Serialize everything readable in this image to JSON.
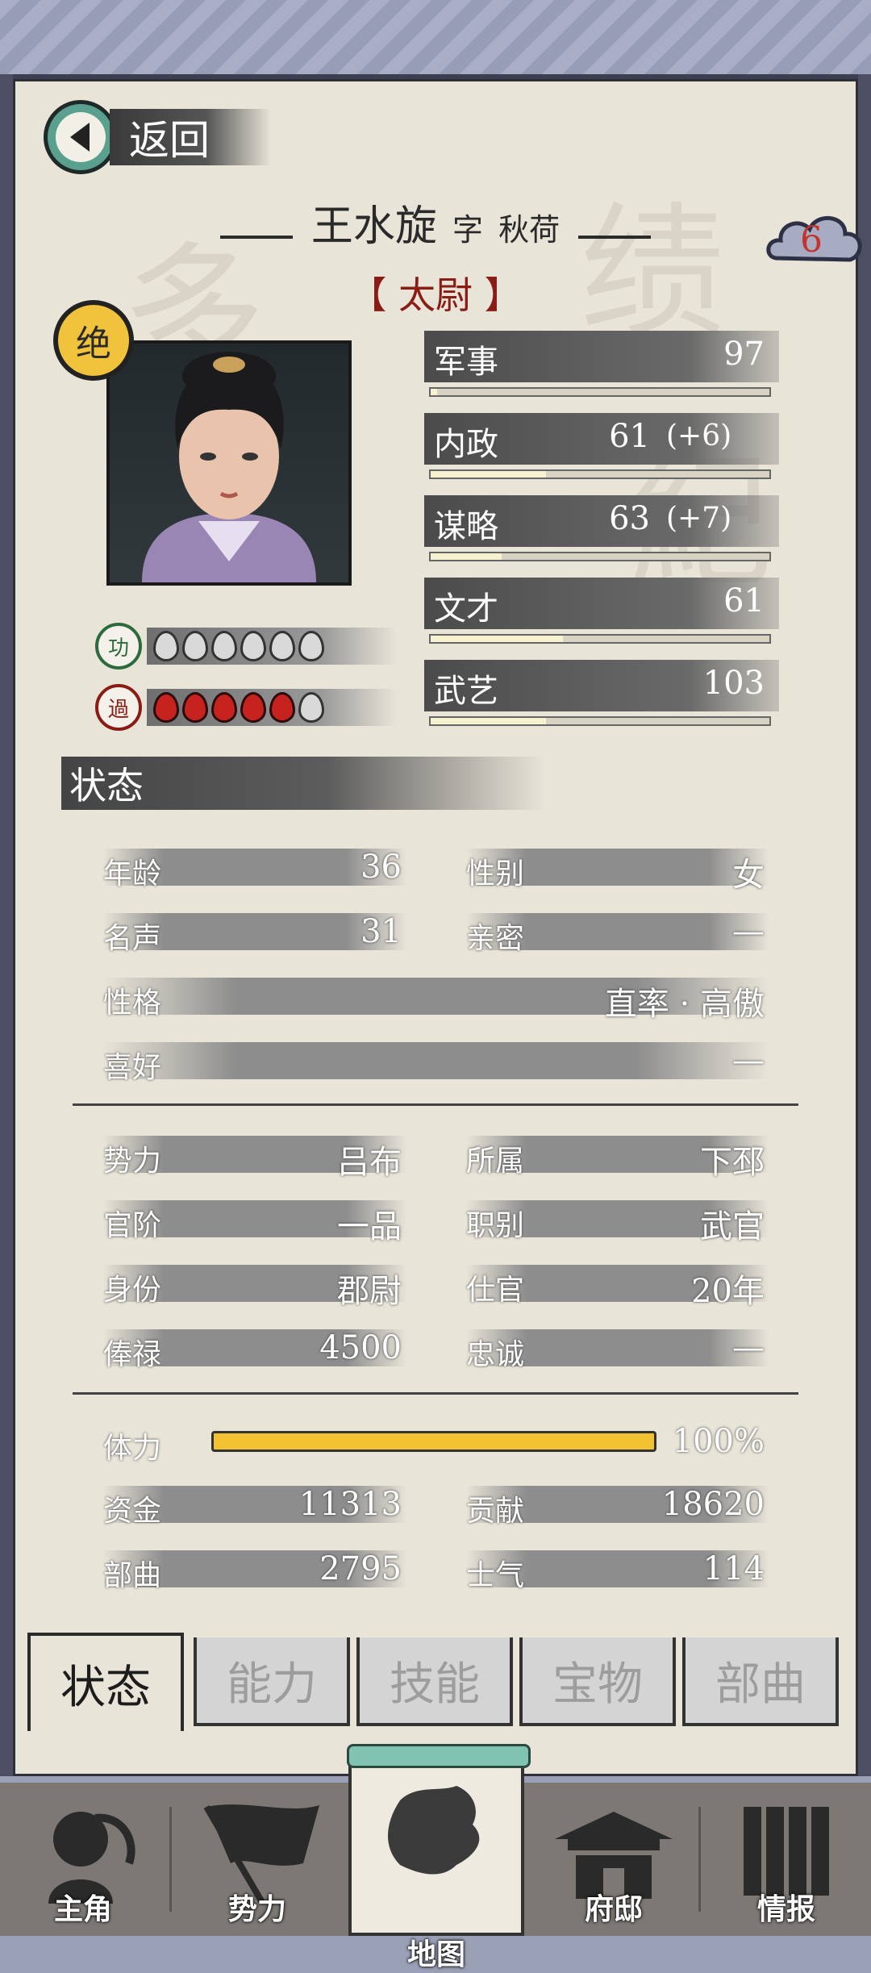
{
  "header": {
    "back_label": "返回"
  },
  "character": {
    "name": "王水旋",
    "courtesy_prefix": "字",
    "courtesy_name": "秋荷",
    "title": "【 太尉 】",
    "rank_badge": "绝",
    "cloud_number": "6",
    "merit_label": "功",
    "demerit_label": "過",
    "merit_count": 0,
    "demerit_count": 5
  },
  "attributes": [
    {
      "label": "军事",
      "value": "97",
      "bonus": "",
      "fill": 0.02
    },
    {
      "label": "内政",
      "value": "61",
      "bonus": "(+6)",
      "fill": 0.34
    },
    {
      "label": "谋略",
      "value": "63",
      "bonus": "(+7)",
      "fill": 0.21
    },
    {
      "label": "文才",
      "value": "61",
      "bonus": "",
      "fill": 0.39
    },
    {
      "label": "武艺",
      "value": "103",
      "bonus": "",
      "fill": 0.34
    }
  ],
  "status_section": {
    "title": "状态"
  },
  "status": {
    "age": {
      "label": "年龄",
      "value": "36"
    },
    "gender": {
      "label": "性别",
      "value": "女"
    },
    "fame": {
      "label": "名声",
      "value": "31"
    },
    "intimacy": {
      "label": "亲密",
      "value": "—"
    },
    "personality": {
      "label": "性格",
      "value": "直率 · 高傲"
    },
    "hobby": {
      "label": "喜好",
      "value": "—"
    },
    "faction": {
      "label": "势力",
      "value": "吕布"
    },
    "location": {
      "label": "所属",
      "value": "下邳"
    },
    "rank": {
      "label": "官阶",
      "value": "一品"
    },
    "post_type": {
      "label": "职别",
      "value": "武官"
    },
    "identity": {
      "label": "身份",
      "value": "郡尉"
    },
    "service": {
      "label": "仕官",
      "value": "20年"
    },
    "salary": {
      "label": "俸禄",
      "value": "4500"
    },
    "loyalty": {
      "label": "忠诚",
      "value": "—"
    },
    "stamina": {
      "label": "体力",
      "value": "100%",
      "percent": 100
    },
    "funds": {
      "label": "资金",
      "value": "11313"
    },
    "contribution": {
      "label": "贡献",
      "value": "18620"
    },
    "troops": {
      "label": "部曲",
      "value": "2795"
    },
    "morale": {
      "label": "士气",
      "value": "114"
    }
  },
  "tabs": [
    {
      "label": "状态",
      "active": true
    },
    {
      "label": "能力",
      "active": false
    },
    {
      "label": "技能",
      "active": false
    },
    {
      "label": "宝物",
      "active": false
    },
    {
      "label": "部曲",
      "active": false
    }
  ],
  "nav": [
    {
      "label": "主角",
      "icon": "hero-icon"
    },
    {
      "label": "势力",
      "icon": "flag-icon"
    },
    {
      "label": "地图",
      "icon": "map-icon"
    },
    {
      "label": "府邸",
      "icon": "mansion-icon"
    },
    {
      "label": "情报",
      "icon": "scroll-icon"
    }
  ],
  "colors": {
    "paper": "#e9e4d8",
    "accent": "#5aa08e",
    "title_red": "#8a1c16",
    "stamina": "#f3c232",
    "badge": "#f1c23b"
  }
}
